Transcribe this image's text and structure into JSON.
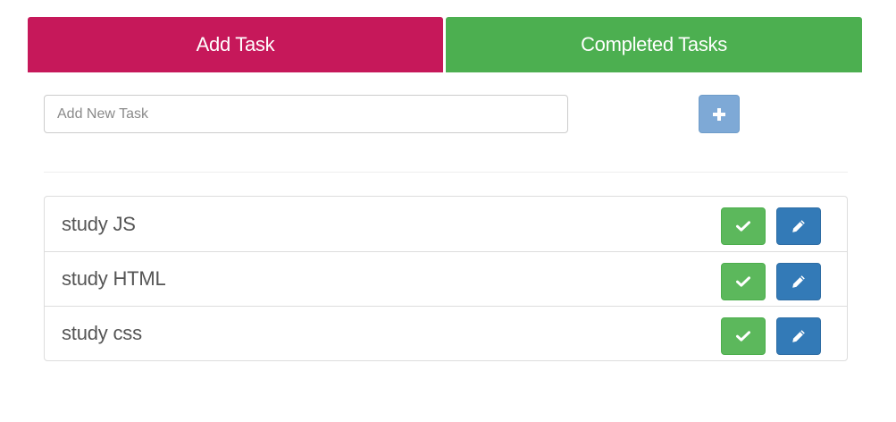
{
  "tabs": {
    "add_task": "Add Task",
    "completed_tasks": "Completed Tasks"
  },
  "new_task": {
    "placeholder": "Add New Task",
    "value": ""
  },
  "add_button": {
    "icon": "plus-icon"
  },
  "tasks": [
    {
      "label": "study JS",
      "complete_icon": "check-icon",
      "edit_icon": "pencil-icon"
    },
    {
      "label": "study HTML",
      "complete_icon": "check-icon",
      "edit_icon": "pencil-icon"
    },
    {
      "label": "study css",
      "complete_icon": "check-icon",
      "edit_icon": "pencil-icon"
    }
  ],
  "colors": {
    "add_tab": "#c6185a",
    "completed_tab": "#4caf50",
    "add_button": "#7ea9d6",
    "complete_button": "#5cb85c",
    "edit_button": "#337ab7"
  }
}
